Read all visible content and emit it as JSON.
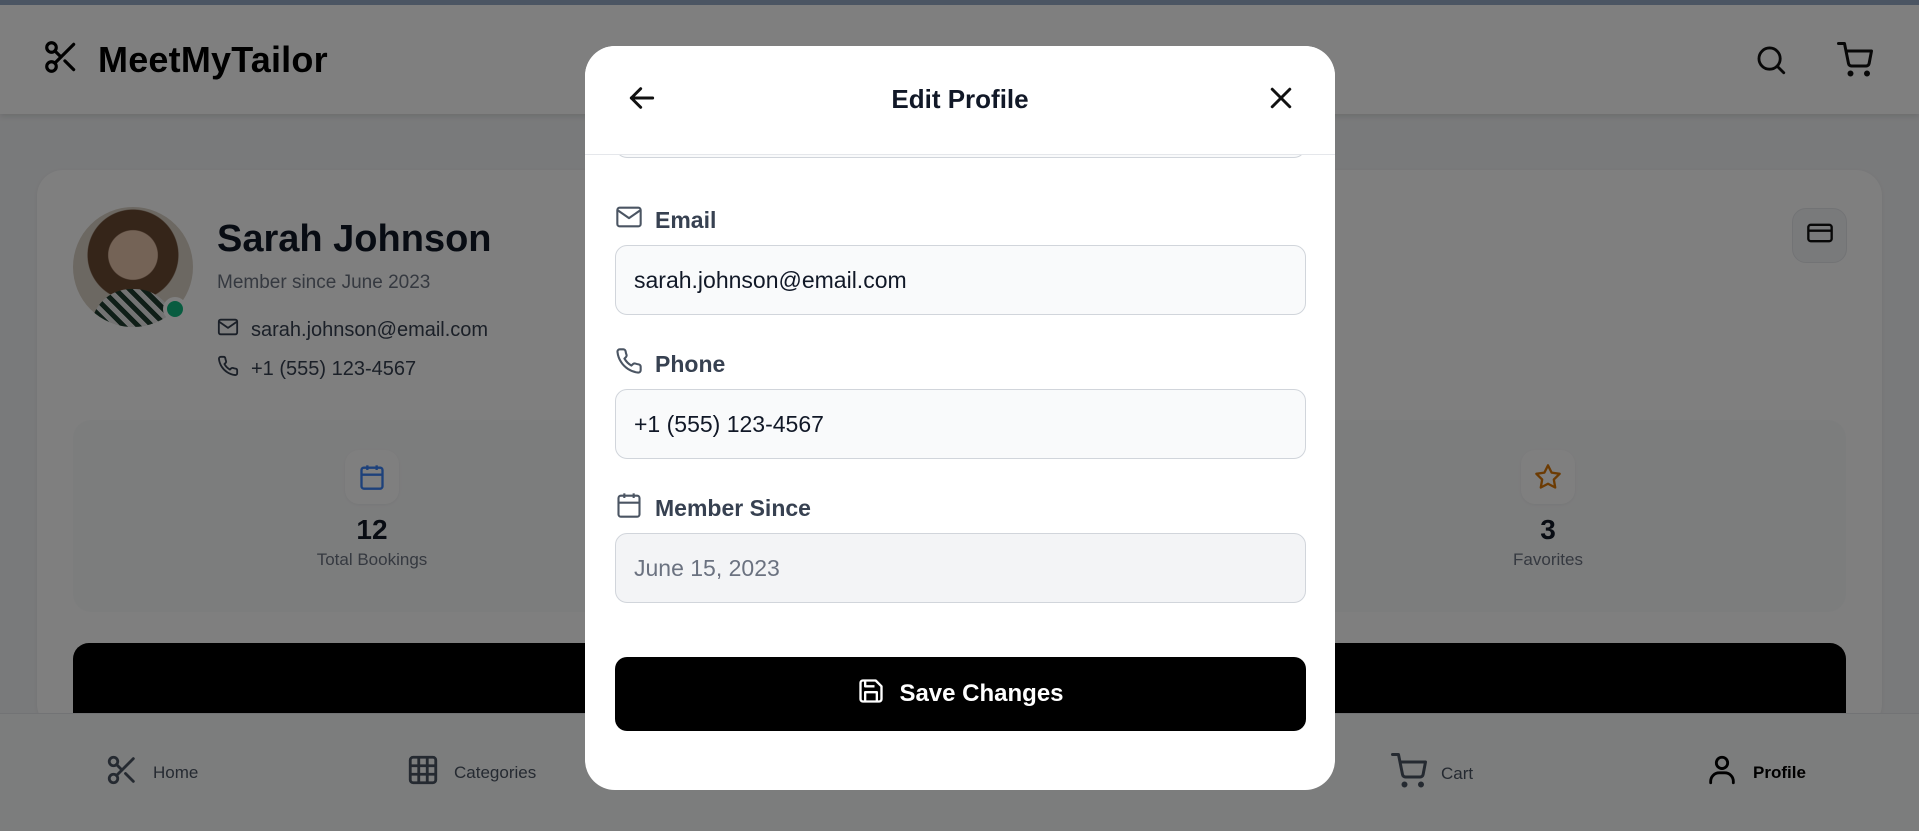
{
  "app": {
    "name": "MeetMyTailor"
  },
  "header": {
    "search_icon": "search-icon",
    "cart_icon": "cart-icon"
  },
  "profile": {
    "name": "Sarah Johnson",
    "member_since": "Member since June 2023",
    "email": "sarah.johnson@email.com",
    "phone": "+1 (555) 123-4567",
    "status": "online"
  },
  "stats": [
    {
      "value": "12",
      "label": "Total Bookings",
      "icon": "calendar-icon",
      "color": "#3b82f6"
    },
    {
      "value": "3",
      "label": "Favorites",
      "icon": "star-icon",
      "color": "#d97706"
    }
  ],
  "bottom_nav": [
    {
      "label": "Home",
      "icon": "scissors-icon"
    },
    {
      "label": "Categories",
      "icon": "grid-icon"
    },
    {
      "label": "Cart",
      "icon": "cart-icon"
    },
    {
      "label": "Profile",
      "icon": "user-icon",
      "active": true
    }
  ],
  "modal": {
    "title": "Edit Profile",
    "fields": [
      {
        "label": "Email",
        "icon": "mail-icon",
        "value": "sarah.johnson@email.com",
        "editable": true
      },
      {
        "label": "Phone",
        "icon": "phone-icon",
        "value": "+1 (555) 123-4567",
        "editable": true
      },
      {
        "label": "Member Since",
        "icon": "calendar-icon",
        "value": "June 15, 2023",
        "editable": false
      }
    ],
    "save_label": "Save Changes"
  },
  "colors": {
    "accent": "#000000",
    "online": "#10b981",
    "overlay": "rgba(0,0,0,0.5)"
  }
}
